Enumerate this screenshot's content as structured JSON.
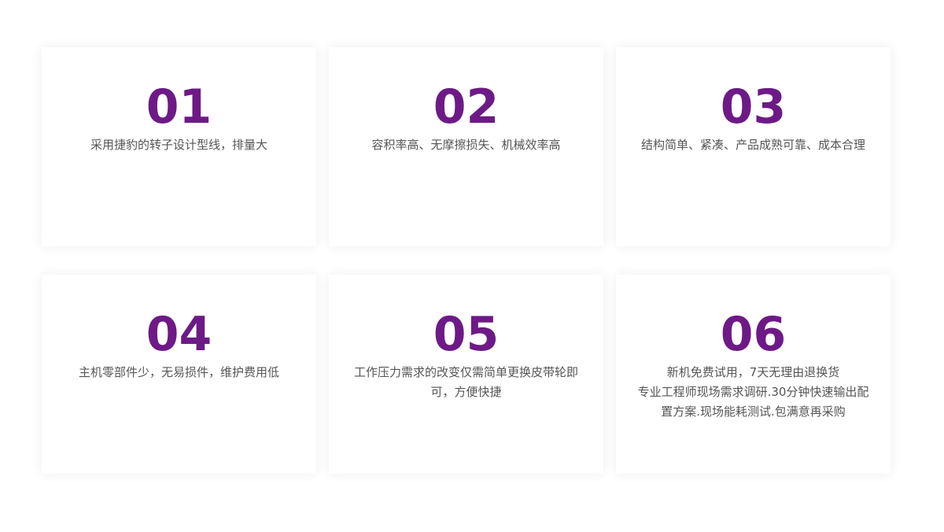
{
  "cards": [
    {
      "number": "01",
      "text": "采用捷豹的转子设计型线，排量大"
    },
    {
      "number": "02",
      "text": "容积率高、无摩擦损失、机械效率高"
    },
    {
      "number": "03",
      "text": "结构简单、紧凑、产品成熟可靠、成本合理"
    },
    {
      "number": "04",
      "text": "主机零部件少，无易损件，维护费用低"
    },
    {
      "number": "05",
      "text": "工作压力需求的改变仅需简单更换皮带轮即可，方便快捷"
    },
    {
      "number": "06",
      "text": "新机免费试用，7天无理由退换货\n专业工程师现场需求调研.30分钟快速输出配置方案.现场能耗测试.包满意再采购"
    }
  ]
}
